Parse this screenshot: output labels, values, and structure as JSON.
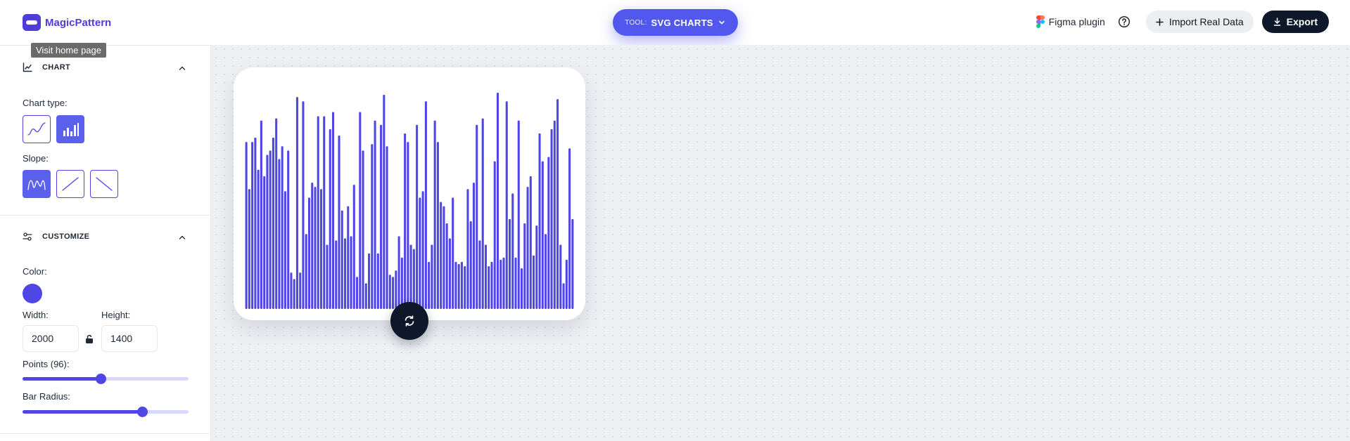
{
  "header": {
    "brand": "MagicPattern",
    "tooltip": "Visit home page",
    "tool_prefix": "TOOL:",
    "tool_name": "SVG CHARTS",
    "figma_label": "Figma plugin",
    "import_label": "Import Real Data",
    "export_label": "Export"
  },
  "sidebar": {
    "chart_section": {
      "title": "CHART",
      "chart_type_label": "Chart type:",
      "chart_types": [
        {
          "icon": "line-chart-icon",
          "selected": false
        },
        {
          "icon": "bar-chart-icon",
          "selected": true
        }
      ],
      "slope_label": "Slope:",
      "slopes": [
        {
          "icon": "wave-slope-icon",
          "selected": true
        },
        {
          "icon": "ascending-slope-icon",
          "selected": false
        },
        {
          "icon": "descending-slope-icon",
          "selected": false
        }
      ]
    },
    "customize_section": {
      "title": "CUSTOMIZE",
      "color_label": "Color:",
      "color": "#4f46e5",
      "width_label": "Width:",
      "width_value": "2000",
      "height_label": "Height:",
      "height_value": "1400",
      "points_label": "Points (96):",
      "points_value": 96,
      "points_fraction": 0.47,
      "bar_radius_label": "Bar Radius:",
      "bar_radius_fraction": 0.72
    }
  },
  "chart_data": {
    "type": "bar",
    "color": "#4f46e5",
    "count": 96,
    "values": [
      78,
      56,
      78,
      80,
      65,
      88,
      62,
      72,
      74,
      80,
      89,
      70,
      76,
      55,
      74,
      17,
      14,
      99,
      17,
      97,
      35,
      52,
      59,
      57,
      90,
      56,
      90,
      30,
      84,
      92,
      32,
      81,
      46,
      33,
      48,
      34,
      58,
      15,
      92,
      74,
      12,
      26,
      77,
      88,
      26,
      86,
      100,
      76,
      16,
      15,
      18,
      34,
      24,
      82,
      78,
      30,
      28,
      86,
      52,
      55,
      97,
      22,
      30,
      88,
      78,
      50,
      48,
      40,
      33,
      52,
      22,
      21,
      22,
      20,
      56,
      41,
      59,
      86,
      32,
      89,
      30,
      20,
      22,
      69,
      101,
      23,
      24,
      97,
      42,
      54,
      24,
      88,
      19,
      40,
      57,
      62,
      25,
      39,
      82,
      69,
      35,
      71,
      84,
      88,
      98,
      30,
      12,
      23,
      75,
      42
    ]
  }
}
